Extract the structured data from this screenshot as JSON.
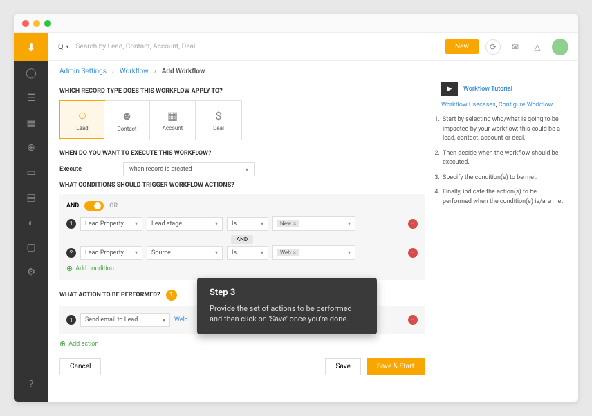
{
  "topbar": {
    "q_label": "Q",
    "search_placeholder": "Search by Lead, Contact, Account, Deal",
    "new_label": "New"
  },
  "breadcrumb": {
    "admin": "Admin Settings",
    "workflow": "Workflow",
    "current": "Add Workflow"
  },
  "sections": {
    "record_type": "WHICH RECORD TYPE DOES THIS WORKFLOW APPLY TO?",
    "execute": "WHEN DO YOU WANT TO EXECUTE THIS WORKFLOW?",
    "conditions": "WHAT CONDITIONS SHOULD TRIGGER WORKFLOW ACTIONS?",
    "actions": "WHAT ACTION TO BE PERFORMED?"
  },
  "record_types": [
    "Lead",
    "Contact",
    "Account",
    "Deal"
  ],
  "execute": {
    "label": "Execute",
    "value": "when record is created"
  },
  "logic": {
    "and": "AND",
    "or": "OR"
  },
  "conditions": [
    {
      "num": "1",
      "prop": "Lead Property",
      "field": "Lead stage",
      "op": "Is",
      "val": "New"
    },
    {
      "num": "2",
      "prop": "Lead Property",
      "field": "Source",
      "op": "Is",
      "val": "Web"
    }
  ],
  "cond_join": "AND",
  "add_condition": "Add condition",
  "action_step_num": "1",
  "action": {
    "num": "1",
    "type": "Send email to Lead",
    "template": "Welc"
  },
  "add_action": "Add action",
  "footer": {
    "cancel": "Cancel",
    "save": "Save",
    "save_start": "Save & Start"
  },
  "sidebar": {
    "tutorial_label": "Workflow Tutorial",
    "usecases": "Workflow Usecases",
    "configure": "Configure Workflow",
    "steps": [
      "Start by selecting who/what is going to be impacted by your workflow: this could be a lead, contact, account or deal.",
      "Then decide when the workflow should be executed.",
      "Specify the condition(s) to be met.",
      "Finally, indicate the action(s) to be performed when the condition(s) is/are met."
    ]
  },
  "tooltip": {
    "title": "Step 3",
    "body": "Provide the set of actions to be performed and then click on 'Save' once you're done."
  }
}
